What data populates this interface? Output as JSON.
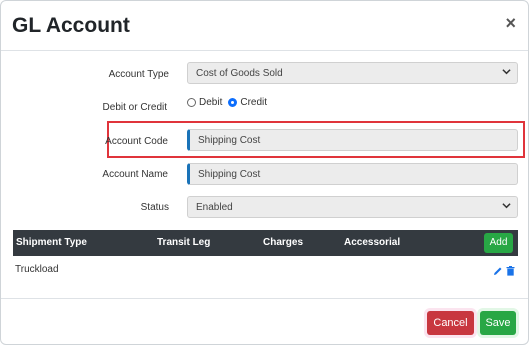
{
  "modal": {
    "title": "GL Account",
    "close_glyph": "×"
  },
  "form": {
    "account_type": {
      "label": "Account Type",
      "value": "Cost of Goods Sold"
    },
    "debit_credit": {
      "label": "Debit or Credit",
      "options": [
        {
          "label": "Debit",
          "checked": false
        },
        {
          "label": "Credit",
          "checked": true
        }
      ]
    },
    "account_code": {
      "label": "Account Code",
      "value": "Shipping Cost"
    },
    "account_name": {
      "label": "Account Name",
      "value": "Shipping Cost"
    },
    "status": {
      "label": "Status",
      "value": "Enabled"
    }
  },
  "table": {
    "columns": [
      "Shipment Type",
      "Transit Leg",
      "Charges",
      "Accessorial"
    ],
    "add_label": "Add",
    "rows": [
      {
        "shipment_type": "Truckload",
        "transit_leg": "",
        "charges": "",
        "accessorial": ""
      }
    ]
  },
  "footer": {
    "cancel_label": "Cancel",
    "save_label": "Save"
  },
  "colors": {
    "accent_blue": "#1a73b8",
    "highlight_red": "#e0343b",
    "cancel_red": "#c8373f",
    "save_green": "#28a745",
    "table_header": "#343a40"
  }
}
